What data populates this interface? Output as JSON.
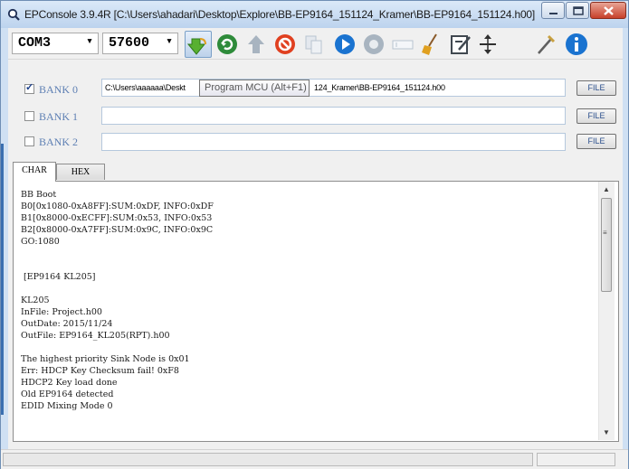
{
  "window": {
    "title": "EPConsole 3.9.4R  [C:\\Users\\ahadari\\Desktop\\Explore\\BB-EP9164_151124_Kramer\\BB-EP9164_151124.h00]"
  },
  "toolbar": {
    "port": "COM3",
    "baud": "57600",
    "buttons": [
      {
        "name": "program-mcu-icon",
        "color": "#58b030"
      },
      {
        "name": "refresh-icon",
        "color": "#2e8b3a"
      },
      {
        "name": "upload-icon",
        "color": "#a8b4c0"
      },
      {
        "name": "stop-icon",
        "color": "#e04020"
      },
      {
        "name": "copy-icon",
        "color": "#b8c4d0"
      },
      {
        "name": "play-icon",
        "color": "#1a73d0"
      },
      {
        "name": "record-icon",
        "color": "#a8b4c0"
      },
      {
        "name": "input-box-icon",
        "color": "#b8c4d0"
      },
      {
        "name": "broom-icon",
        "color": "#e0a020"
      },
      {
        "name": "edit-save-icon",
        "color": "#404850"
      },
      {
        "name": "resize-vertical-icon",
        "color": "#303030"
      },
      {
        "name": "magic-wand-icon",
        "color": "#606060"
      },
      {
        "name": "info-icon",
        "color": "#1a73d0"
      }
    ]
  },
  "tooltip": "Program MCU (Alt+F1)",
  "banks": [
    {
      "label": "BANK 0",
      "checked": true,
      "path_left": "C:\\Users\\aaaaaa\\Deskt",
      "path_right": "124_Kramer\\BB-EP9164_151124.h00",
      "file_label": "FILE"
    },
    {
      "label": "BANK 1",
      "checked": false,
      "path_left": "",
      "path_right": "",
      "file_label": "FILE"
    },
    {
      "label": "BANK 2",
      "checked": false,
      "path_left": "",
      "path_right": "",
      "file_label": "FILE"
    }
  ],
  "tabs": [
    "CHAR",
    "HEX"
  ],
  "console": {
    "lines": "BB Boot\nB0[0x1080-0xA8FF]:SUM:0xDF, INFO:0xDF\nB1[0x8000-0xECFF]:SUM:0x53, INFO:0x53\nB2[0x8000-0xA7FF]:SUM:0x9C, INFO:0x9C\nGO:1080\n\n\n [EP9164 KL205]\n\nKL205\nInFile: Project.h00\nOutDate: 2015/11/24\nOutFile: EP9164_KL205(RPT).h00\n\nThe highest priority Sink Node is 0x01\nErr: HDCP Key Checksum fail! 0xF8\nHDCP2 Key load done\nOld EP9164 detected\nEDID Mixing Mode 0"
  },
  "colors": {
    "title_bar": "#cfe0f3",
    "bank_label": "#5d7fb3",
    "close_button": "#c7402a"
  }
}
